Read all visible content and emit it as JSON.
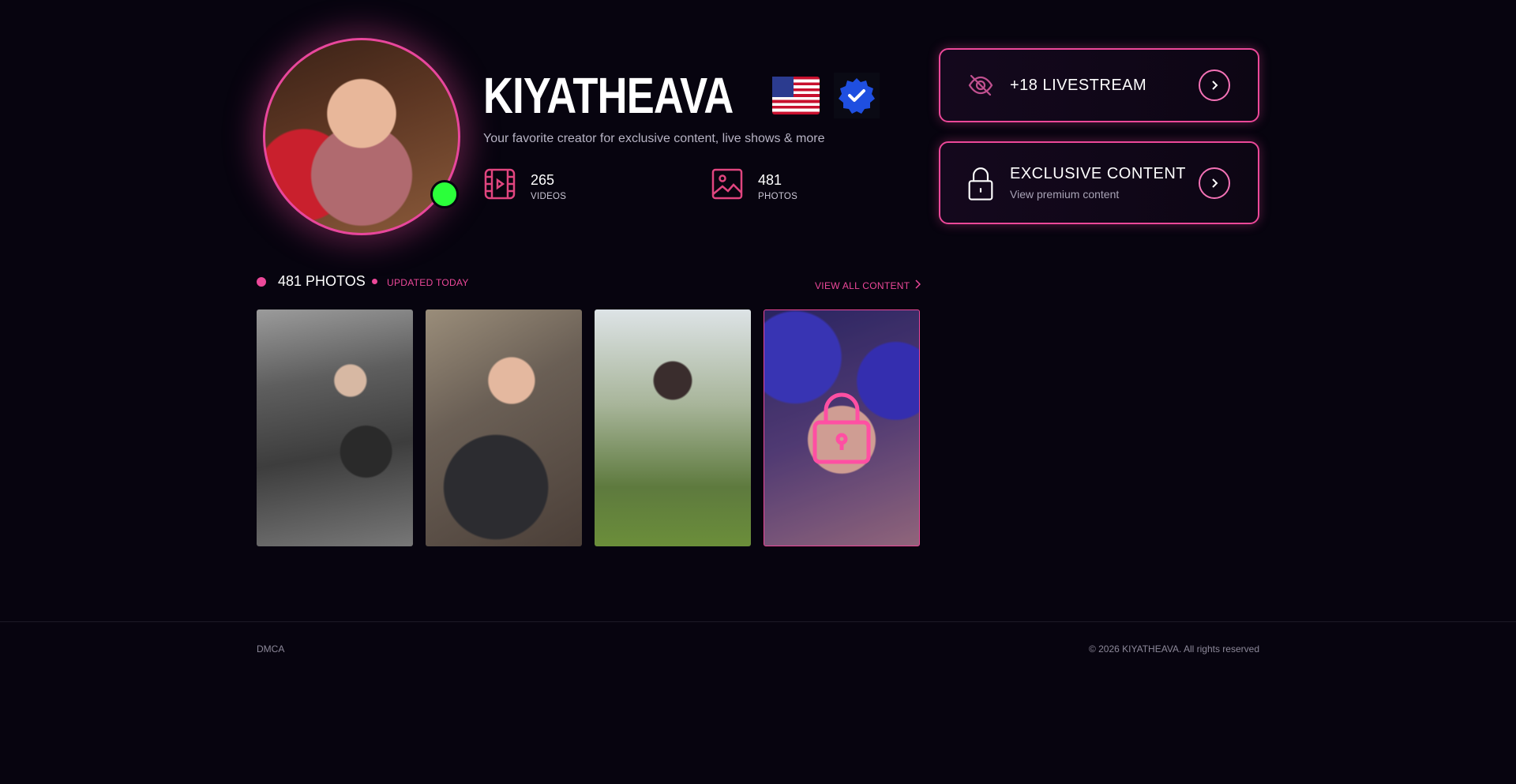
{
  "profile": {
    "name": "KIYATHEAVA",
    "tagline": "Your favorite creator for exclusive content, live shows & more",
    "flag_icon": "us-flag-icon",
    "verified_icon": "verified-badge-icon",
    "online_status_color": "#2bff3a"
  },
  "stats": [
    {
      "value": "265",
      "label": "VIDEOS",
      "icon": "film-icon"
    },
    {
      "value": "481",
      "label": "PHOTOS",
      "icon": "image-icon"
    }
  ],
  "cards": [
    {
      "title": "+18 LIVESTREAM",
      "subtitle": "",
      "icon": "eye-off-icon"
    },
    {
      "title": "EXCLUSIVE CONTENT",
      "subtitle": "View premium content",
      "icon": "lock-icon"
    }
  ],
  "photos_section": {
    "title": "481 PHOTOS",
    "updated": "UPDATED TODAY",
    "view_all": "VIEW ALL CONTENT",
    "thumbnail_count": 4,
    "locked_index": 3
  },
  "footer": {
    "left": "DMCA",
    "right": "© 2026 KIYATHEAVA. All rights reserved"
  },
  "colors": {
    "accent": "#ec4899",
    "background": "#07040f"
  }
}
